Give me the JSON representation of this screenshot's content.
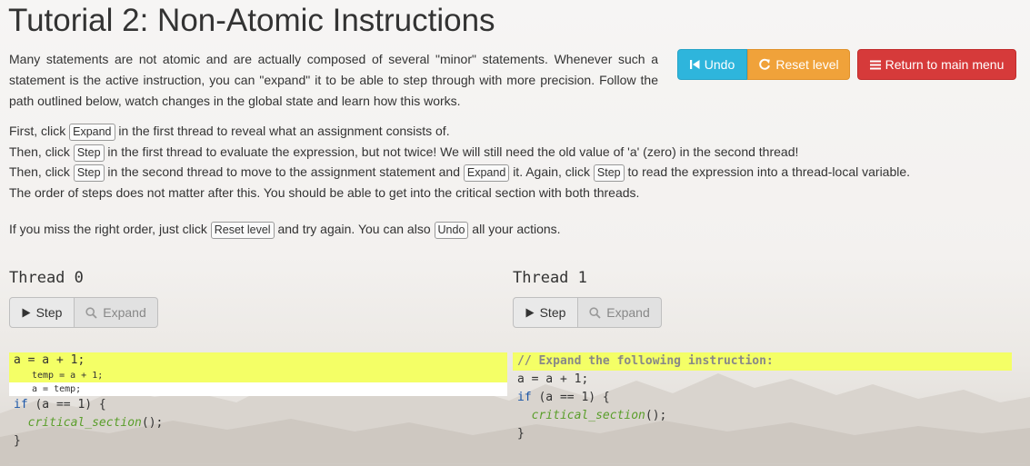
{
  "title": "Tutorial 2: Non-Atomic Instructions",
  "intro": "Many statements are not atomic and are actually composed of several \"minor\" statements. Whenever such a statement is the active instruction, you can \"expand\" it to be able to step through with more precision. Follow the path outlined below, watch changes in the global state and learn how this works.",
  "steps": {
    "s1_a": "First, click",
    "s1_btn": "Expand",
    "s1_b": "in the first thread to reveal what an assignment consists of.",
    "s2_a": "Then, click",
    "s2_btn": "Step",
    "s2_b": "in the first thread to evaluate the expression, but not twice! We will still need the old value of 'a' (zero) in the second thread!",
    "s3_a": "Then, click",
    "s3_btn1": "Step",
    "s3_b": "in the second thread to move to the assignment statement and",
    "s3_btn2": "Expand",
    "s3_c": "it. Again, click",
    "s3_btn3": "Step",
    "s3_d": "to read the expression into a thread-local variable.",
    "s4": "The order of steps does not matter after this. You should be able to get into the critical section with both threads.",
    "s5_a": "If you miss the right order, just click",
    "s5_btn1": "Reset level",
    "s5_b": "and try again. You can also",
    "s5_btn2": "Undo",
    "s5_c": "all your actions."
  },
  "toolbar": {
    "undo_label": "Undo",
    "reset_label": "Reset level",
    "main_menu_label": "Return to main menu"
  },
  "colors": {
    "undo": "#2eb5dc",
    "reset": "#f0a23a",
    "main_menu": "#d63a3a",
    "highlight": "#f4ff66"
  },
  "threads": [
    {
      "title": "Thread 0",
      "step_label": "Step",
      "expand_label": "Expand",
      "code": {
        "l1": "a = a + 1;",
        "sub1": "temp = a + 1;",
        "sub2": "a = temp;",
        "l2_kw": "if",
        "l2_rest": " (a == 1) {",
        "l3_fn": "critical_section",
        "l3_rest": "();",
        "l4": "}"
      }
    },
    {
      "title": "Thread 1",
      "step_label": "Step",
      "expand_label": "Expand",
      "code": {
        "comment": "// Expand the following instruction:",
        "l1": "a = a + 1;",
        "l2_kw": "if",
        "l2_rest": " (a == 1) {",
        "l3_fn": "critical_section",
        "l3_rest": "();",
        "l4": "}"
      }
    }
  ]
}
